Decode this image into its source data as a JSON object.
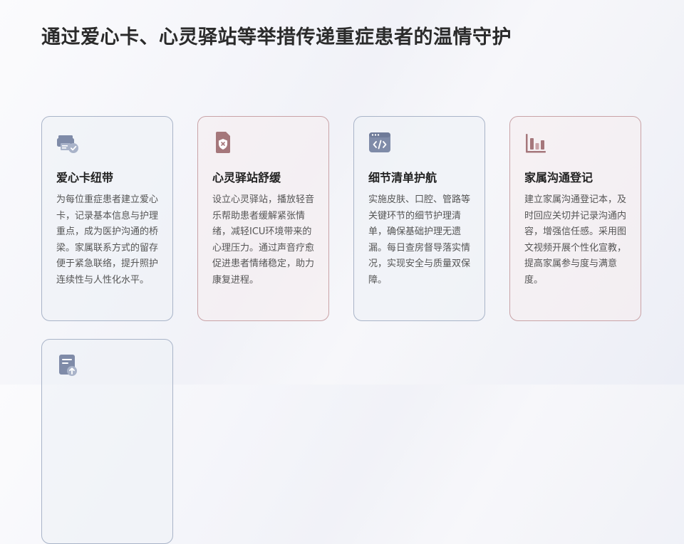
{
  "page": {
    "title": "通过爱心卡、心灵驿站等举措传递重症患者的温情守护"
  },
  "colors": {
    "blue_accent": "#7f8ba8",
    "red_accent": "#a5777b"
  },
  "cards": [
    {
      "icon": "printer-check-icon",
      "title": "爱心卡纽带",
      "desc": "为每位重症患者建立爱心卡，记录基本信息与护理重点，成为医护沟通的桥梁。家属联系方式的留存便于紧急联络，提升照护连续性与人性化水平。"
    },
    {
      "icon": "shield-tools-icon",
      "title": "心灵驿站舒缓",
      "desc": "设立心灵驿站，播放轻音乐帮助患者缓解紧张情绪，减轻ICU环境带来的心理压力。通过声音疗愈促进患者情绪稳定，助力康复进程。"
    },
    {
      "icon": "code-window-icon",
      "title": "细节清单护航",
      "desc": "实施皮肤、口腔、管路等关键环节的细节护理清单，确保基础护理无遗漏。每日查房督导落实情况，实现安全与质量双保障。"
    },
    {
      "icon": "bar-chart-icon",
      "title": "家属沟通登记",
      "desc": "建立家属沟通登记本，及时回应关切并记录沟通内容，增强信任感。采用图文视频开展个性化宣教，提高家属参与度与满意度。"
    },
    {
      "icon": "document-upload-icon",
      "title": "",
      "desc": ""
    }
  ]
}
